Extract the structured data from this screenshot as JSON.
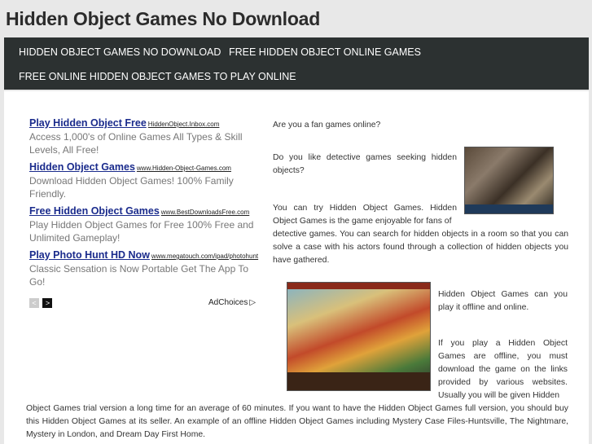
{
  "site": {
    "title": "Hidden Object Games No Download"
  },
  "nav": {
    "items": [
      {
        "label": "HIDDEN OBJECT GAMES NO DOWNLOAD"
      },
      {
        "label": "FREE HIDDEN OBJECT ONLINE GAMES"
      },
      {
        "label": "FREE ONLINE HIDDEN OBJECT GAMES TO PLAY ONLINE"
      }
    ]
  },
  "ads": {
    "items": [
      {
        "title": "Play Hidden Object Free",
        "url": "HiddenObject.Inbox.com",
        "desc": "Access 1,000's of Online Games All Types & Skill Levels, All Free!"
      },
      {
        "title": "Hidden Object Games",
        "url": "www.Hidden-Object-Games.com",
        "desc": "Download Hidden Object Games! 100% Family Friendly."
      },
      {
        "title": "Free Hidden Object Games",
        "url": "www.BestDownloadsFree.com",
        "desc": "Play Hidden Object Games for Free 100% Free and Unlimited Gameplay!"
      },
      {
        "title": "Play Photo Hunt HD Now",
        "url": "www.megatouch.com/ipad/photohunt",
        "desc": "Classic Sensation is Now Portable Get The App To Go!"
      }
    ],
    "prev_label": "<",
    "next_label": ">",
    "adchoices_label": "AdChoices"
  },
  "article": {
    "p1": "Are you a fan games online?",
    "p2": "Do you like detective games seeking hidden objects?",
    "p3a": "You can try Hidden Object Games. Hidden Object Games is the game enjoyable for fans of",
    "p3b": "detective games. You can search for hidden objects in a room so that you can solve a case with his actors found through a collection of hidden objects you have gathered.",
    "p4": "Hidden Object Games can you play it offline and online.",
    "p5": "If you play a Hidden Object Games are offline, you must download the game on the links provided by various websites. Usually you will be given Hidden",
    "p6": "Object Games trial version a long time for an average of 60 minutes. If you want to have the Hidden Object Games full version, you should buy this Hidden Object Games at its seller. An example of an offline Hidden Object Games including Mystery Case Files-Huntsville, The Nightmare, Mystery in London, and Dream Day First Home."
  }
}
